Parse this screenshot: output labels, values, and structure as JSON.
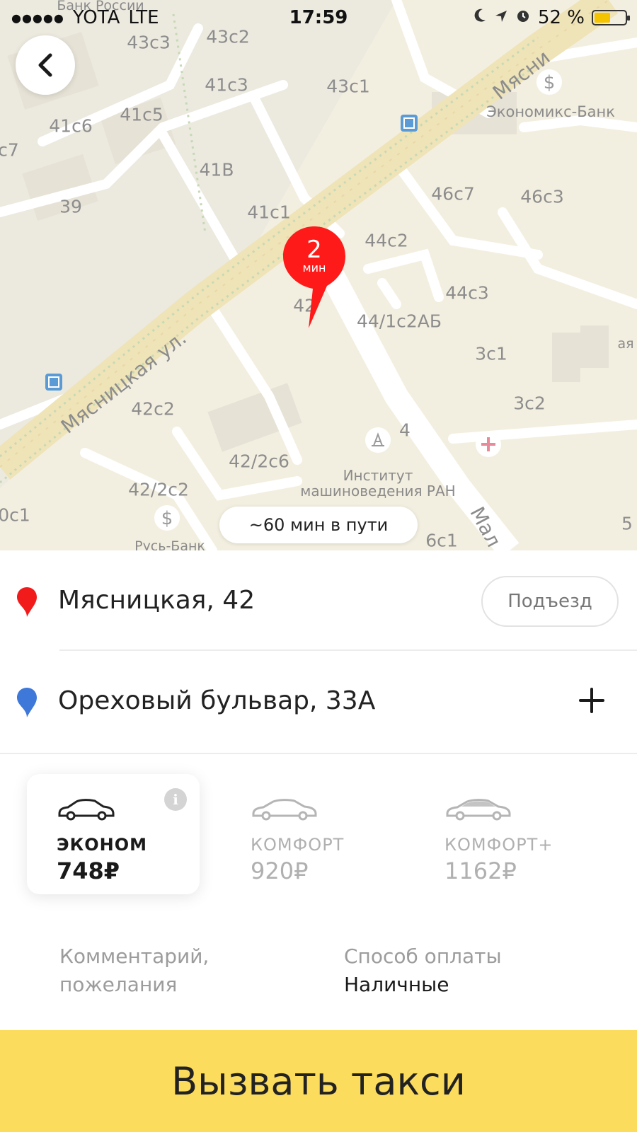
{
  "status_bar": {
    "carrier": "YOTA",
    "network": "LTE",
    "time": "17:59",
    "battery_text": "52 %",
    "battery_level": 0.52,
    "icons": [
      "signal-dots-icon",
      "moon-icon",
      "location-arrow-icon",
      "alarm-icon",
      "battery-icon"
    ]
  },
  "map": {
    "streets": {
      "main": "Мясницкая ул.",
      "top": "Мясни",
      "side": "Мал"
    },
    "buildings": [
      "43с3",
      "43с2",
      "41с3",
      "43с1",
      "41с6",
      "41с5",
      "с7",
      "41В",
      "39",
      "41с1",
      "44с2",
      "46с7",
      "46с3",
      "44с3",
      "42",
      "44/1с2АБ",
      "3с1",
      "3с2",
      "42с2",
      "4",
      "42/2с6",
      "42/2с2",
      "0с1",
      "6с1",
      "5",
      "ая"
    ],
    "pois": {
      "bank_top": "Банк России",
      "bank_right": "Экономикс-Банк",
      "institute_line1": "Институт",
      "institute_line2": "машиноведения РАН",
      "bank_bottom": "Русь-Банк"
    },
    "pickup_pin": {
      "eta_number": "2",
      "eta_unit": "мин",
      "color": "#ff1a1a"
    },
    "eta_chip": "~60 мин в пути"
  },
  "route": {
    "from": {
      "address": "Мясницкая, 42",
      "pin_color": "#f21b1b",
      "entrance_label": "Подъезд"
    },
    "to": {
      "address": "Ореховый бульвар, 33А",
      "pin_color": "#3e78d8",
      "add_icon": "plus-icon"
    }
  },
  "tariffs": [
    {
      "name": "ЭКОНОМ",
      "price": "748₽",
      "selected": true,
      "icon": "car-outline-icon"
    },
    {
      "name": "КОМФОРТ",
      "price": "920₽",
      "selected": false,
      "icon": "car-outline-icon"
    },
    {
      "name": "КОМФОРТ+",
      "price": "1162₽",
      "selected": false,
      "icon": "car-premium-icon"
    }
  ],
  "options": {
    "comment_line1": "Комментарий,",
    "comment_line2": "пожелания",
    "payment_label": "Способ оплаты",
    "payment_value": "Наличные"
  },
  "cta": {
    "label": "Вызвать такси",
    "color": "#fcdc5c"
  }
}
